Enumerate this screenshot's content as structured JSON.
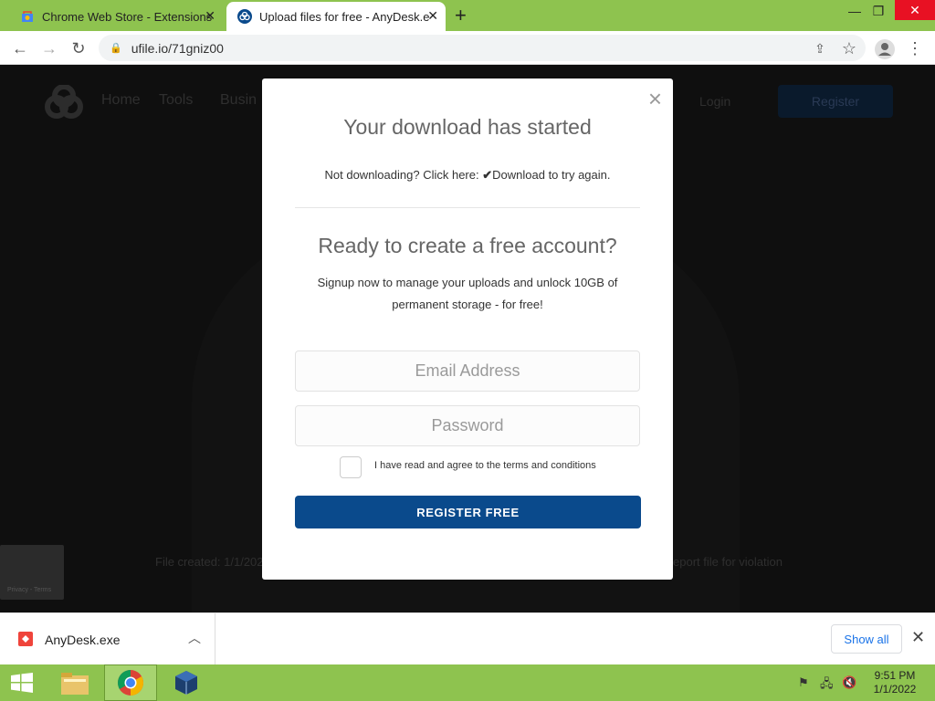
{
  "browser": {
    "tabs": [
      {
        "title": "Chrome Web Store - Extensions",
        "active": false
      },
      {
        "title": "Upload files for free - AnyDesk.e",
        "active": true
      }
    ],
    "url": "ufile.io/71gniz00"
  },
  "background_page": {
    "nav": [
      "Home",
      "Tools",
      "Busin"
    ],
    "login": "Login",
    "register": "Register",
    "footer_left": "File created: 1/1/202",
    "footer_right": "eport file for violation",
    "recaptcha_text": "Privacy - Terms"
  },
  "modal": {
    "download_title": "Your download has started",
    "retry_prefix": "Not downloading? Click here:",
    "retry_link": "Download to try again.",
    "account_title": "Ready to create a free account?",
    "account_desc": "Signup now to manage your uploads and unlock 10GB of permanent storage - for free!",
    "email_placeholder": "Email Address",
    "password_placeholder": "Password",
    "terms_label": "I have read and agree to the terms and conditions",
    "register_button": "REGISTER FREE"
  },
  "download_shelf": {
    "file_name": "AnyDesk.exe",
    "show_all": "Show all"
  },
  "taskbar": {
    "time": "9:51 PM",
    "date": "1/1/2022"
  },
  "colors": {
    "accent": "#0a4a8c",
    "tab_strip": "#8ec34f",
    "download_icon": "#ef443b"
  }
}
